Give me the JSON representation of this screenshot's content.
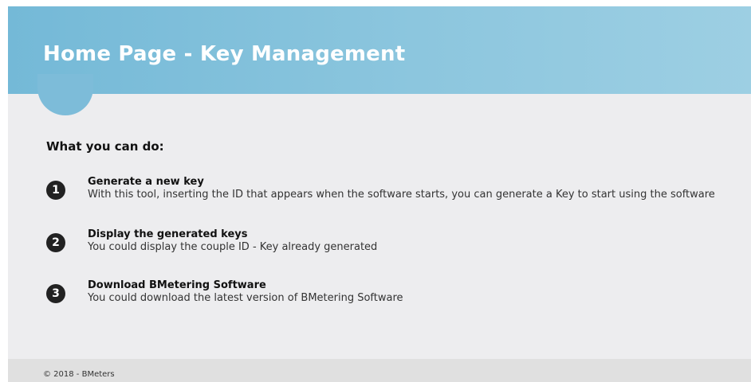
{
  "header": {
    "title": "Home Page - Key Management"
  },
  "main": {
    "section_heading": "What you can do:",
    "features": [
      {
        "number": "1",
        "title": "Generate a new key",
        "description": "With this tool, inserting the ID that appears when the software starts, you can generate a Key to start using the software"
      },
      {
        "number": "2",
        "title": "Display the generated keys",
        "description": "You could display the couple ID - Key already generated"
      },
      {
        "number": "3",
        "title": "Download BMetering Software",
        "description": "You could download the latest version of BMetering Software"
      }
    ]
  },
  "footer": {
    "copyright": "© 2018 - BMeters"
  },
  "colors": {
    "header_start": "#74b9d7",
    "header_end": "#9dcfe3",
    "page_background": "#ededef",
    "footer_background": "#e0e0e0",
    "number_badge": "#222222"
  }
}
